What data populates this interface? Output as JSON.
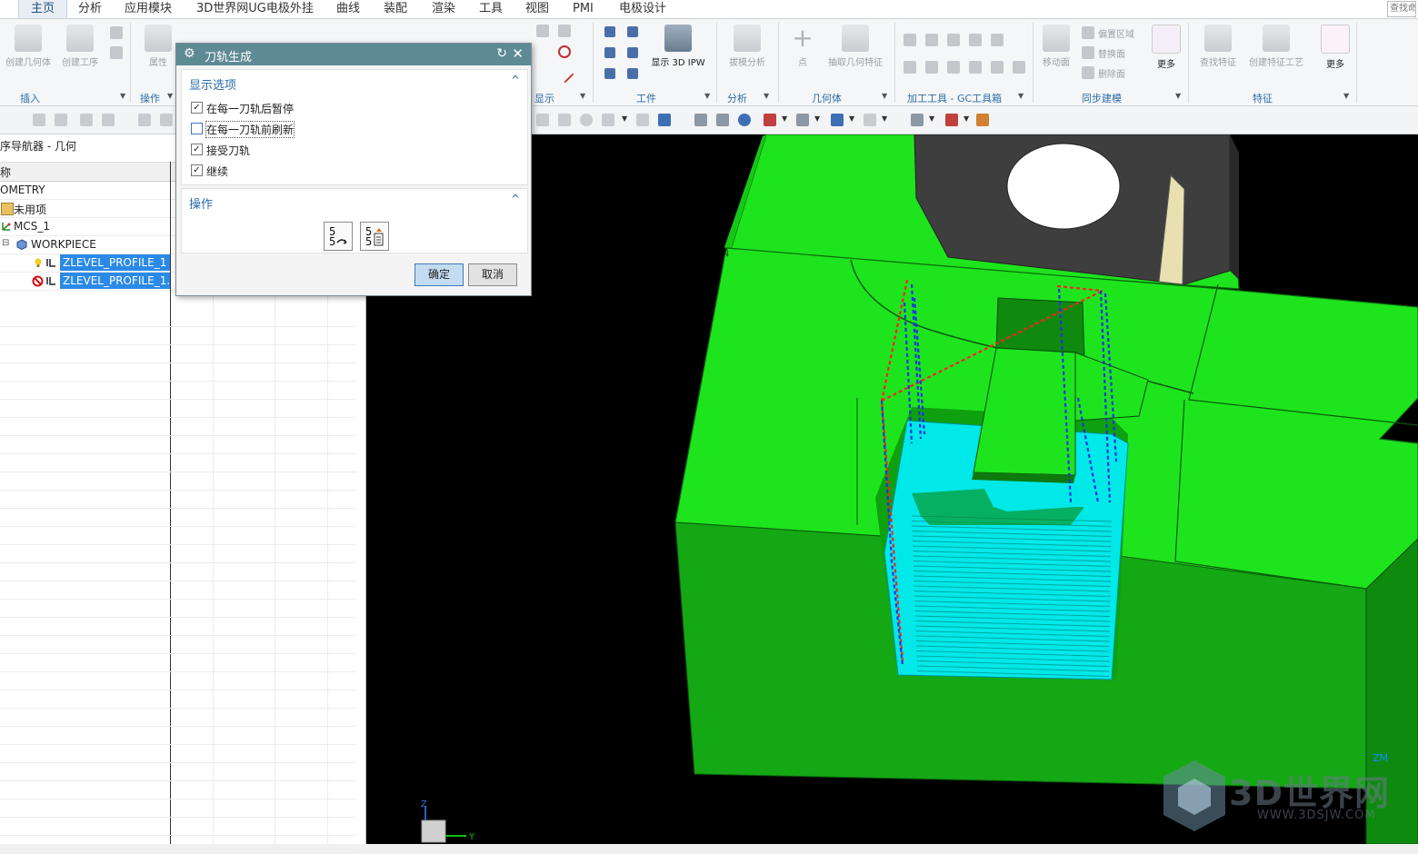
{
  "menu": {
    "tabs": [
      "主页",
      "分析",
      "应用模块",
      "3D世界网UG电极外挂",
      "曲线",
      "装配",
      "渲染",
      "工具",
      "视图",
      "PMI",
      "电极设计"
    ],
    "active": "主页",
    "search_text": "查找命"
  },
  "ribbon": {
    "create_geometry": "创建几何体",
    "create_operation": "创建工序",
    "property": "属性",
    "show_3d_ipw": "显示 3D IPW",
    "draft_analysis": "拔模分析",
    "point": "点",
    "extract_geometry": "抽取几何特征",
    "move_face": "移动面",
    "offset_region": "偏置区域",
    "replace_face": "替换面",
    "delete_face": "删除面",
    "more_1": "更多",
    "find_feature": "查找特征",
    "create_feature_process": "创建特征工艺",
    "more_2": "更多",
    "groups": {
      "insert": "插入",
      "operation": "操作",
      "display": "显示",
      "workpiece": "工件",
      "analysis": "分析",
      "geometry": "几何体",
      "gc_tools": "加工工具 - GC工具箱",
      "sync_modeling": "同步建模",
      "feature": "特征"
    }
  },
  "navigator": {
    "title": "序导航器 - 几何",
    "column_header": "称",
    "rows": {
      "geometry": "OMETRY",
      "unused": "未用项",
      "mcs": "MCS_1",
      "workpiece": "WORKPIECE",
      "op1": "ZLEVEL_PROFILE_1",
      "op2": "ZLEVEL_PROFILE_1..."
    }
  },
  "dialog": {
    "title": "刀轨生成",
    "display_section": "显示选项",
    "options": [
      {
        "label": "在每一刀轨后暂停",
        "checked": true
      },
      {
        "label": "在每一刀轨前刷新",
        "checked": false
      },
      {
        "label": "接受刀轨",
        "checked": true
      },
      {
        "label": "继续",
        "checked": true
      }
    ],
    "action_section": "操作",
    "ok": "确定",
    "cancel": "取消"
  },
  "viewport": {
    "axis_z": "Z",
    "axis_y": "Y",
    "corner_label": "ZM"
  },
  "watermark": {
    "text": "3D世界网",
    "url": "WWW.3DSJW.COM"
  },
  "colors": {
    "model_green": "#18e018",
    "cavity_cyan": "#00f0f0",
    "toolpath_blue": "#1a35e0",
    "toolpath_red": "#ff2020",
    "dialog_title": "#5e8a94",
    "selection_blue": "#2b8ae6"
  }
}
